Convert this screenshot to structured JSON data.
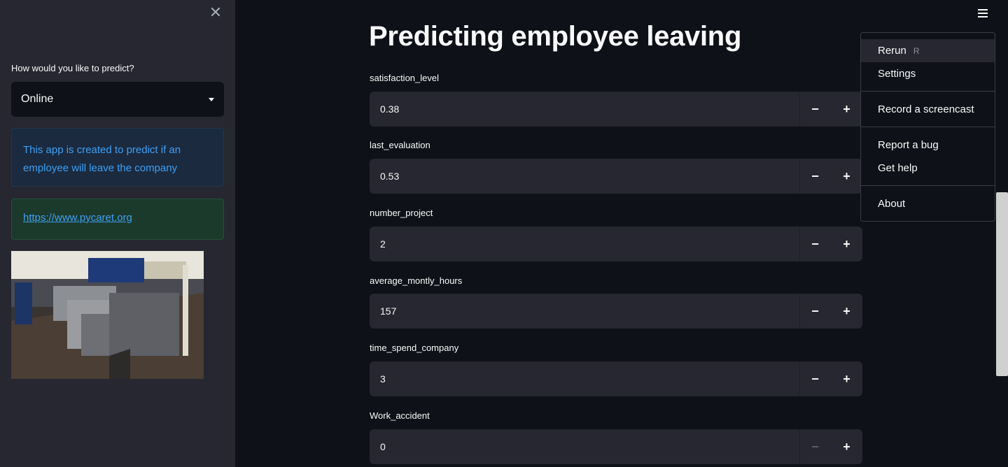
{
  "sidebar": {
    "close_icon": "close-icon",
    "predict_label": "How would you like to predict?",
    "predict_value": "Online",
    "info_text": "This app is created to predict if an employee will leave the company",
    "link_text": "https://www.pycaret.org"
  },
  "main": {
    "title": "Predicting employee leaving",
    "fields": [
      {
        "label": "satisfaction_level",
        "value": "0.38"
      },
      {
        "label": "last_evaluation",
        "value": "0.53"
      },
      {
        "label": "number_project",
        "value": "2"
      },
      {
        "label": "average_montly_hours",
        "value": "157"
      },
      {
        "label": "time_spend_company",
        "value": "3"
      },
      {
        "label": "Work_accident",
        "value": "0"
      }
    ],
    "minus_glyph": "−",
    "plus_glyph": "+"
  },
  "menu": {
    "items": [
      {
        "label": "Rerun",
        "shortcut": "R"
      },
      {
        "label": "Settings"
      },
      {
        "label": "Record a screencast"
      },
      {
        "label": "Report a bug"
      },
      {
        "label": "Get help"
      },
      {
        "label": "About"
      }
    ]
  },
  "colors": {
    "background": "#0e1117",
    "sidebar": "#262730",
    "info_text": "#3ea0f5",
    "input_bg": "#262730"
  }
}
